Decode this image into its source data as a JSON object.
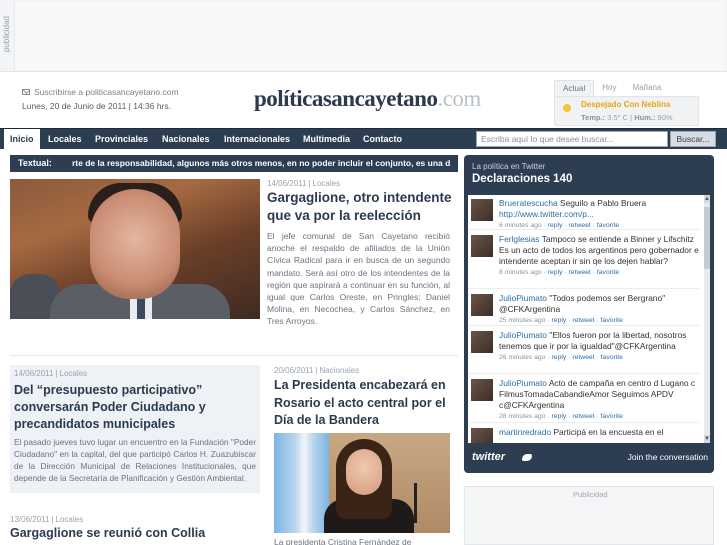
{
  "ad_top": {
    "label": "publicidad"
  },
  "header": {
    "subscribe": "Suscribirse a politicasancayetano.com",
    "date": "Lunes, 20 de Junio de 2011  |  14:36 hrs.",
    "logo_part1": "política",
    "logo_part2": "sancayetano",
    "logo_part3": ".com"
  },
  "weather": {
    "tabs": [
      "Actual",
      "Hoy",
      "Mañana"
    ],
    "condition": "Despejado Con Neblina",
    "temp_label": "Temp.:",
    "temp_value": "3.5° C",
    "hum_label": "Hum.:",
    "hum_value": "90%"
  },
  "nav": {
    "items": [
      "Inicio",
      "Locales",
      "Provinciales",
      "Nacionales",
      "Internacionales",
      "Multimedia",
      "Contacto"
    ],
    "search_placeholder": "Escriba aquí lo que desee buscar...",
    "search_button": "Buscar..."
  },
  "ticker": {
    "label": "Textual:",
    "text": "rte de la responsabilidad, algunos más otros menos, en no poder incluir el conjunto, es una d"
  },
  "main_story": {
    "date": "14/06/2011",
    "category": "Locales",
    "title": "Gargaglione, otro intendente que va por la reelección",
    "body": "El jefe comunal de San Cayetano recibió anoche el respaldo de afiliados de la Unión Cívica Radical para ir en busca de un segundo mandato. Será así otro de los intendentes de la región que aspirará a continuar en su función, al igual que Carlos Oreste, en Pringles; Daniel Molina, en Necochea, y Carlos Sánchez, en Tres Arroyos."
  },
  "story_left": {
    "date": "14/06/2011",
    "category": "Locales",
    "title": "Del “presupuesto participativo” conversarán Poder Ciudadano y precandidatos municipales",
    "body": "El pasado jueves tuvo lugar un encuentro en la Fundación \"Poder Ciudadano\" en la capital, del que participó Carlos H. Zuazubiscar de la Dirección Municipal de Relaciones Institucionales, que depende de la Secretaría de Planificación y Gestión Ambiental."
  },
  "story_right": {
    "date": "20/06/2011",
    "category": "Nacionales",
    "title": "La Presidenta encabezará en Rosario el acto central por el Día de la Bandera",
    "caption": "La presidenta Cristina Fernández de"
  },
  "story_bottom": {
    "date": "13/06/2011",
    "category": "Locales",
    "title": "Gargaglione se reunió con Collia"
  },
  "twitter": {
    "subtitle": "La política en Twitter",
    "title": "Declaraciones 140",
    "reply": "reply",
    "retweet": "retweet",
    "favorite": "favorite",
    "tweets": [
      {
        "user": "Brueratescucha",
        "text": "Seguilo a Pablo Bruera",
        "link": "http://www.twitter.com/p...",
        "time": "6 minutes ago"
      },
      {
        "user": "Ferlglesias",
        "text": "Tampoco se entiende a Binner y Lifschitz Es un acto de todos los argentinos pero gobernador e intendente aceptan ir sin qe los dejen hablar?",
        "link": "",
        "time": "8 minutes ago"
      },
      {
        "user": "JulioPiumato",
        "text": "\"Todos podemos ser Bergrano\" @CFKArgentina",
        "link": "",
        "time": "25 minutes ago"
      },
      {
        "user": "JulioPiumato",
        "text": "\"Ellos fueron por la libertad, nosotros tenemos que ir por la igualdad\"@CFKArgentina",
        "link": "",
        "time": "26 minutes ago"
      },
      {
        "user": "JulioPiumato",
        "text": "Acto de campaña en centro d Lugano c FilmusTomadaCabandieAmor Seguimos APDV c@CFKArgentina",
        "link": "",
        "time": "28 minutes ago"
      },
      {
        "user": "martinredrado",
        "text": "Participá en la encuesta en el",
        "link": "",
        "time": ""
      }
    ],
    "footer_logo": "twitter",
    "join": "Join the conversation"
  },
  "ad_right": {
    "label": "Publicidad"
  }
}
